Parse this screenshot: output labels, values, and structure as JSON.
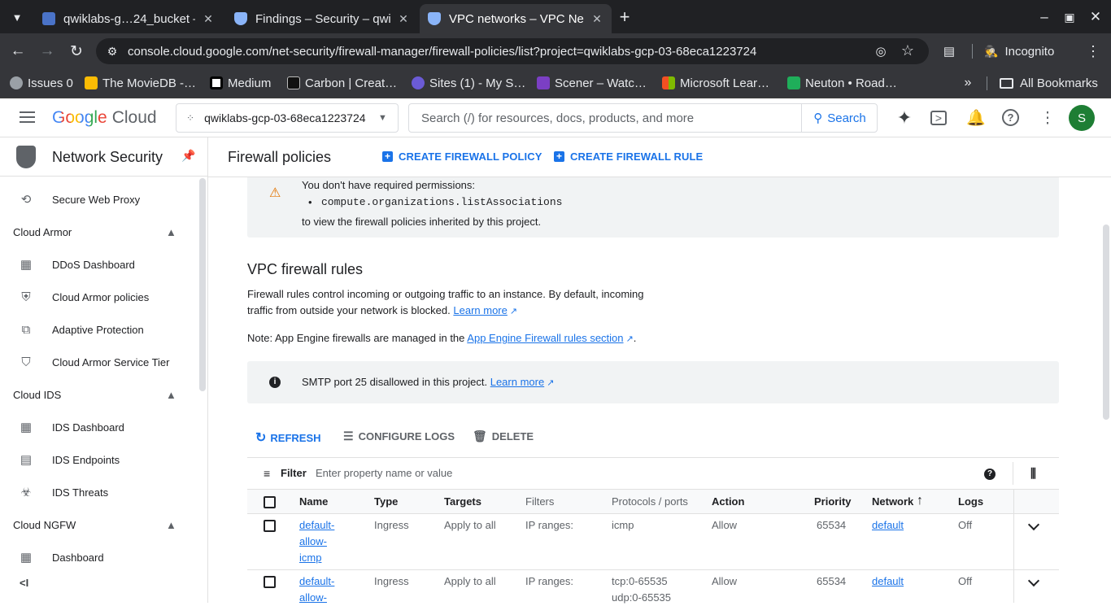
{
  "browser": {
    "tabs": [
      {
        "title": "qwiklabs-g…24_bucket –",
        "color": "#4a73c8"
      },
      {
        "title": "Findings – Security – qwi",
        "color": "#8ab4f8"
      },
      {
        "title": "VPC networks – VPC Net",
        "color": "#8ab4f8"
      }
    ],
    "url": "console.cloud.google.com/net-security/firewall-manager/firewall-policies/list?project=qwiklabs-gcp-03-68eca1223724",
    "incognito_label": "Incognito",
    "bookmarks": [
      {
        "label": "Issues 0",
        "color": "#9aa0a6"
      },
      {
        "label": "The MovieDB -…",
        "color": "#fbbc04"
      },
      {
        "label": "Medium",
        "color": "#000000"
      },
      {
        "label": "Carbon | Creat…",
        "color": "#111111"
      },
      {
        "label": "Sites (1) - My S…",
        "color": "#6b5bd6"
      },
      {
        "label": "Scener – Watc…",
        "color": "#7b3fc4"
      },
      {
        "label": "Microsoft Lear…",
        "color": "#f25022"
      },
      {
        "label": "Neuton • Road…",
        "color": "#1fae5a"
      }
    ],
    "all_bookmarks_label": "All Bookmarks"
  },
  "header": {
    "logo_google": "Google",
    "logo_cloud": "Cloud",
    "project": "qwiklabs-gcp-03-68eca1223724",
    "search_placeholder": "Search (/) for resources, docs, products, and more",
    "search_button": "Search",
    "avatar_letter": "S"
  },
  "sidebar": {
    "product_title": "Network Security",
    "items": [
      {
        "type": "item",
        "label": "Secure Web Proxy",
        "icon": "proxy-icon"
      },
      {
        "type": "header",
        "label": "Cloud Armor"
      },
      {
        "type": "item",
        "label": "DDoS Dashboard",
        "icon": "dashboard-icon"
      },
      {
        "type": "item",
        "label": "Cloud Armor policies",
        "icon": "shield-icon"
      },
      {
        "type": "item",
        "label": "Adaptive Protection",
        "icon": "adaptive-icon"
      },
      {
        "type": "item",
        "label": "Cloud Armor Service Tier",
        "icon": "tier-icon"
      },
      {
        "type": "header",
        "label": "Cloud IDS"
      },
      {
        "type": "item",
        "label": "IDS Dashboard",
        "icon": "dashboard-icon"
      },
      {
        "type": "item",
        "label": "IDS Endpoints",
        "icon": "endpoint-icon"
      },
      {
        "type": "item",
        "label": "IDS Threats",
        "icon": "threat-icon"
      },
      {
        "type": "header",
        "label": "Cloud NGFW"
      },
      {
        "type": "item",
        "label": "Dashboard",
        "icon": "dashboard-icon"
      }
    ]
  },
  "page": {
    "title": "Firewall policies",
    "create_policy": "CREATE FIREWALL POLICY",
    "create_rule": "CREATE FIREWALL RULE",
    "perm_line1": "You don't have required permissions:",
    "perm_item": "compute.organizations.listAssociations",
    "perm_line3": "to view the firewall policies inherited by this project.",
    "section_title": "VPC firewall rules",
    "desc_line1": "Firewall rules control incoming or outgoing traffic to an instance. By default, incoming",
    "desc_line2": "traffic from outside your network is blocked.",
    "learn_more": "Learn more",
    "note_prefix": "Note: App Engine firewalls are managed in the",
    "note_link": "App Engine Firewall rules section",
    "note_suffix": ".",
    "smtp_text": "SMTP port 25 disallowed in this project.",
    "smtp_link": "Learn more",
    "refresh": "REFRESH",
    "configure_logs": "CONFIGURE LOGS",
    "delete": "DELETE",
    "filter_label": "Filter",
    "filter_placeholder": "Enter property name or value"
  },
  "table": {
    "columns": [
      "Name",
      "Type",
      "Targets",
      "Filters",
      "Protocols / ports",
      "Action",
      "Priority",
      "Network",
      "Logs"
    ],
    "rows": [
      {
        "name_lines": [
          "default-",
          "allow-",
          "icmp"
        ],
        "type": "Ingress",
        "targets": "Apply to all",
        "filters": "IP ranges:",
        "protocols": [
          "icmp"
        ],
        "action": "Allow",
        "priority": "65534",
        "network": "default",
        "logs": "Off"
      },
      {
        "name_lines": [
          "default-",
          "allow-"
        ],
        "type": "Ingress",
        "targets": "Apply to all",
        "filters": "IP ranges:",
        "protocols": [
          "tcp:0-65535",
          "udp:0-65535"
        ],
        "action": "Allow",
        "priority": "65534",
        "network": "default",
        "logs": "Off"
      }
    ]
  }
}
